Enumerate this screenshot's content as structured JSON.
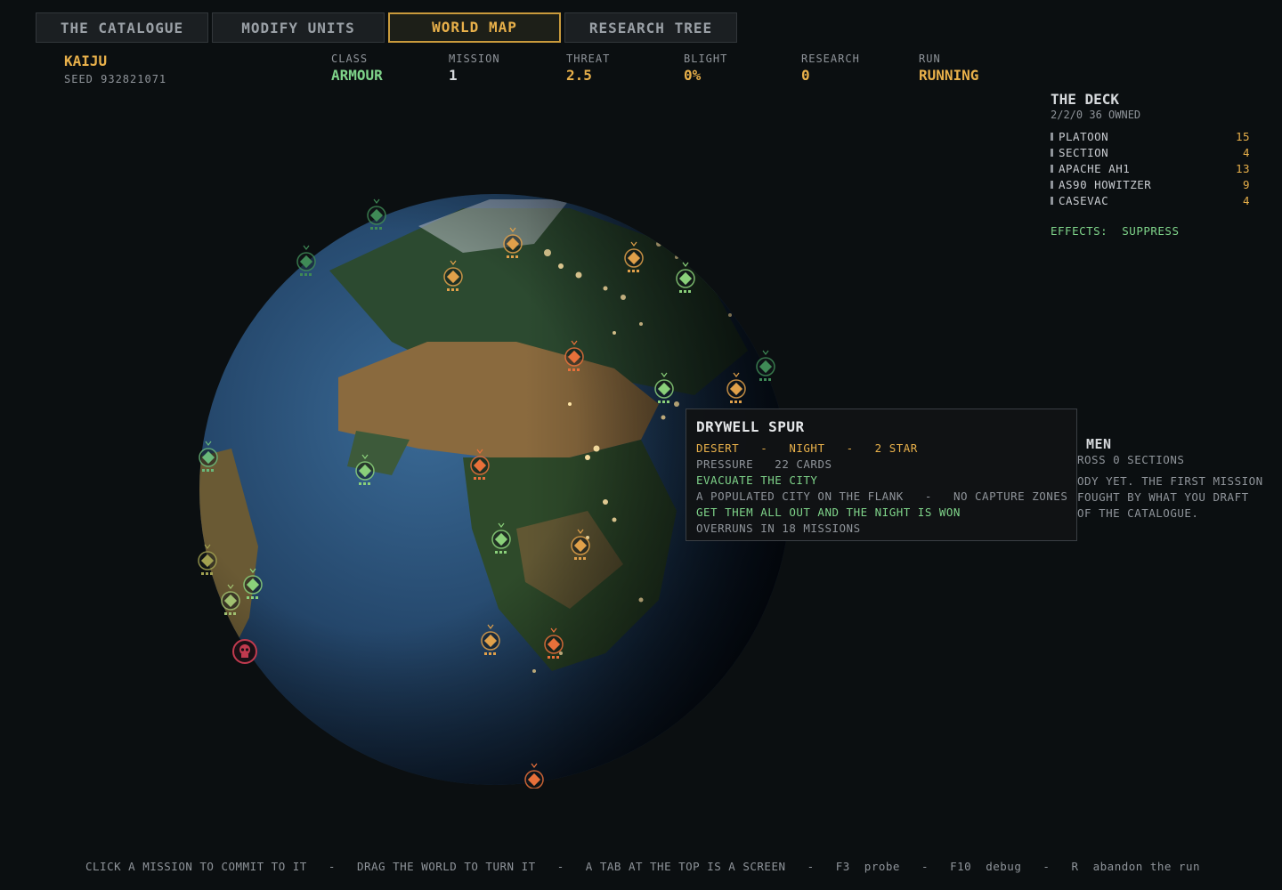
{
  "tabs": [
    {
      "label": "THE CATALOGUE",
      "active": false
    },
    {
      "label": "MODIFY UNITS",
      "active": false
    },
    {
      "label": "WORLD MAP",
      "active": true
    },
    {
      "label": "RESEARCH TREE",
      "active": false
    }
  ],
  "header": {
    "name": "KAIJU",
    "seed": "SEED 932821071",
    "stats": [
      {
        "label": "CLASS",
        "value": "ARMOUR",
        "color": "#7fd48a"
      },
      {
        "label": "MISSION",
        "value": "1",
        "color": "#d6d9dc"
      },
      {
        "label": "THREAT",
        "value": "2.5",
        "color": "#e8b04a"
      },
      {
        "label": "BLIGHT",
        "value": "0%",
        "color": "#e8b04a"
      },
      {
        "label": "RESEARCH",
        "value": "0",
        "color": "#e8b04a"
      },
      {
        "label": "RUN",
        "value": "RUNNING",
        "color": "#e8b04a"
      }
    ]
  },
  "deck": {
    "title": "THE DECK",
    "subtitle": "2/2/0   36 OWNED",
    "items": [
      {
        "name": "PLATOON",
        "count": "15"
      },
      {
        "name": "SECTION",
        "count": "4"
      },
      {
        "name": "APACHE AH1",
        "count": "13"
      },
      {
        "name": "AS90 HOWITZER",
        "count": "9"
      },
      {
        "name": "CASEVAC",
        "count": "4"
      }
    ],
    "effects_label": "EFFECTS:",
    "effects_value": "SUPPRESS"
  },
  "men": {
    "title": "MEN",
    "lines": [
      "ROSS 0 SECTIONS",
      "ODY YET. THE FIRST MISSION",
      "FOUGHT BY WHAT YOU DRAFT",
      "OF THE CATALOGUE."
    ]
  },
  "tooltip": {
    "title": "DRYWELL SPUR",
    "terrain": "DESERT",
    "time": "NIGHT",
    "stars": "2 STAR",
    "sep": "-",
    "pressure_label": "PRESSURE",
    "pressure_value": "22 CARDS",
    "objective": "EVACUATE THE CITY",
    "description": "A POPULATED CITY ON THE FLANK",
    "constraint": "NO CAPTURE ZONES",
    "win": "GET THEM ALL OUT AND THE NIGHT IS WON",
    "overrun": "OVERRUNS IN 18 MISSIONS"
  },
  "footer": "CLICK A MISSION TO COMMIT TO IT   -   DRAG THE WORLD TO TURN IT   -   A TAB AT THE TOP IS A SCREEN   -   F3  probe   -   F10  debug   -   R  abandon the run",
  "colors": {
    "accent": "#e8b04a",
    "good": "#7fd48a",
    "danger": "#c03a4e",
    "ocean": "#24466a",
    "land": "#2c4a30",
    "desert": "#8a6a3e"
  },
  "markers": [
    {
      "color": "#3f8a56",
      "icon": "mission-icon"
    },
    {
      "color": "#3f8a56",
      "icon": "mission-icon"
    },
    {
      "color": "#e0a04a",
      "icon": "mission-icon"
    },
    {
      "color": "#e0a04a",
      "icon": "mission-icon"
    },
    {
      "color": "#e0a04a",
      "icon": "mission-icon"
    },
    {
      "color": "#8ad07a",
      "icon": "mission-icon"
    },
    {
      "color": "#e8703a",
      "icon": "mission-icon"
    },
    {
      "color": "#8ad07a",
      "icon": "mission-icon"
    },
    {
      "color": "#e0a04a",
      "icon": "mission-icon"
    },
    {
      "color": "#3f8a56",
      "icon": "mission-icon"
    },
    {
      "color": "#6ab87a",
      "icon": "mission-icon"
    },
    {
      "color": "#8ad07a",
      "icon": "mission-icon"
    },
    {
      "color": "#e8703a",
      "icon": "mission-icon"
    },
    {
      "color": "#8ad07a",
      "icon": "mission-icon"
    },
    {
      "color": "#e0a04a",
      "icon": "mission-icon"
    },
    {
      "color": "#a0a050",
      "icon": "mission-icon"
    },
    {
      "color": "#8ad07a",
      "icon": "mission-icon"
    },
    {
      "color": "#a0c070",
      "icon": "mission-icon"
    },
    {
      "color": "#e0a04a",
      "icon": "mission-icon"
    },
    {
      "color": "#e8703a",
      "icon": "mission-icon"
    },
    {
      "color": "#e8703a",
      "icon": "mission-icon"
    },
    {
      "color": "#c03a4e",
      "icon": "skull-icon"
    }
  ]
}
